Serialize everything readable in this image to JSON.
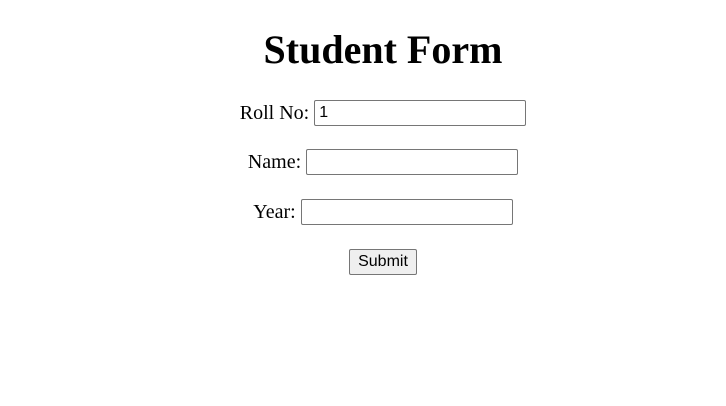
{
  "form": {
    "title": "Student Form",
    "fields": [
      {
        "label": "Roll No:",
        "value": "1",
        "placeholder": ""
      },
      {
        "label": "Name:",
        "value": "",
        "placeholder": ""
      },
      {
        "label": "Year:",
        "value": "",
        "placeholder": ""
      }
    ],
    "submit_label": "Submit"
  }
}
